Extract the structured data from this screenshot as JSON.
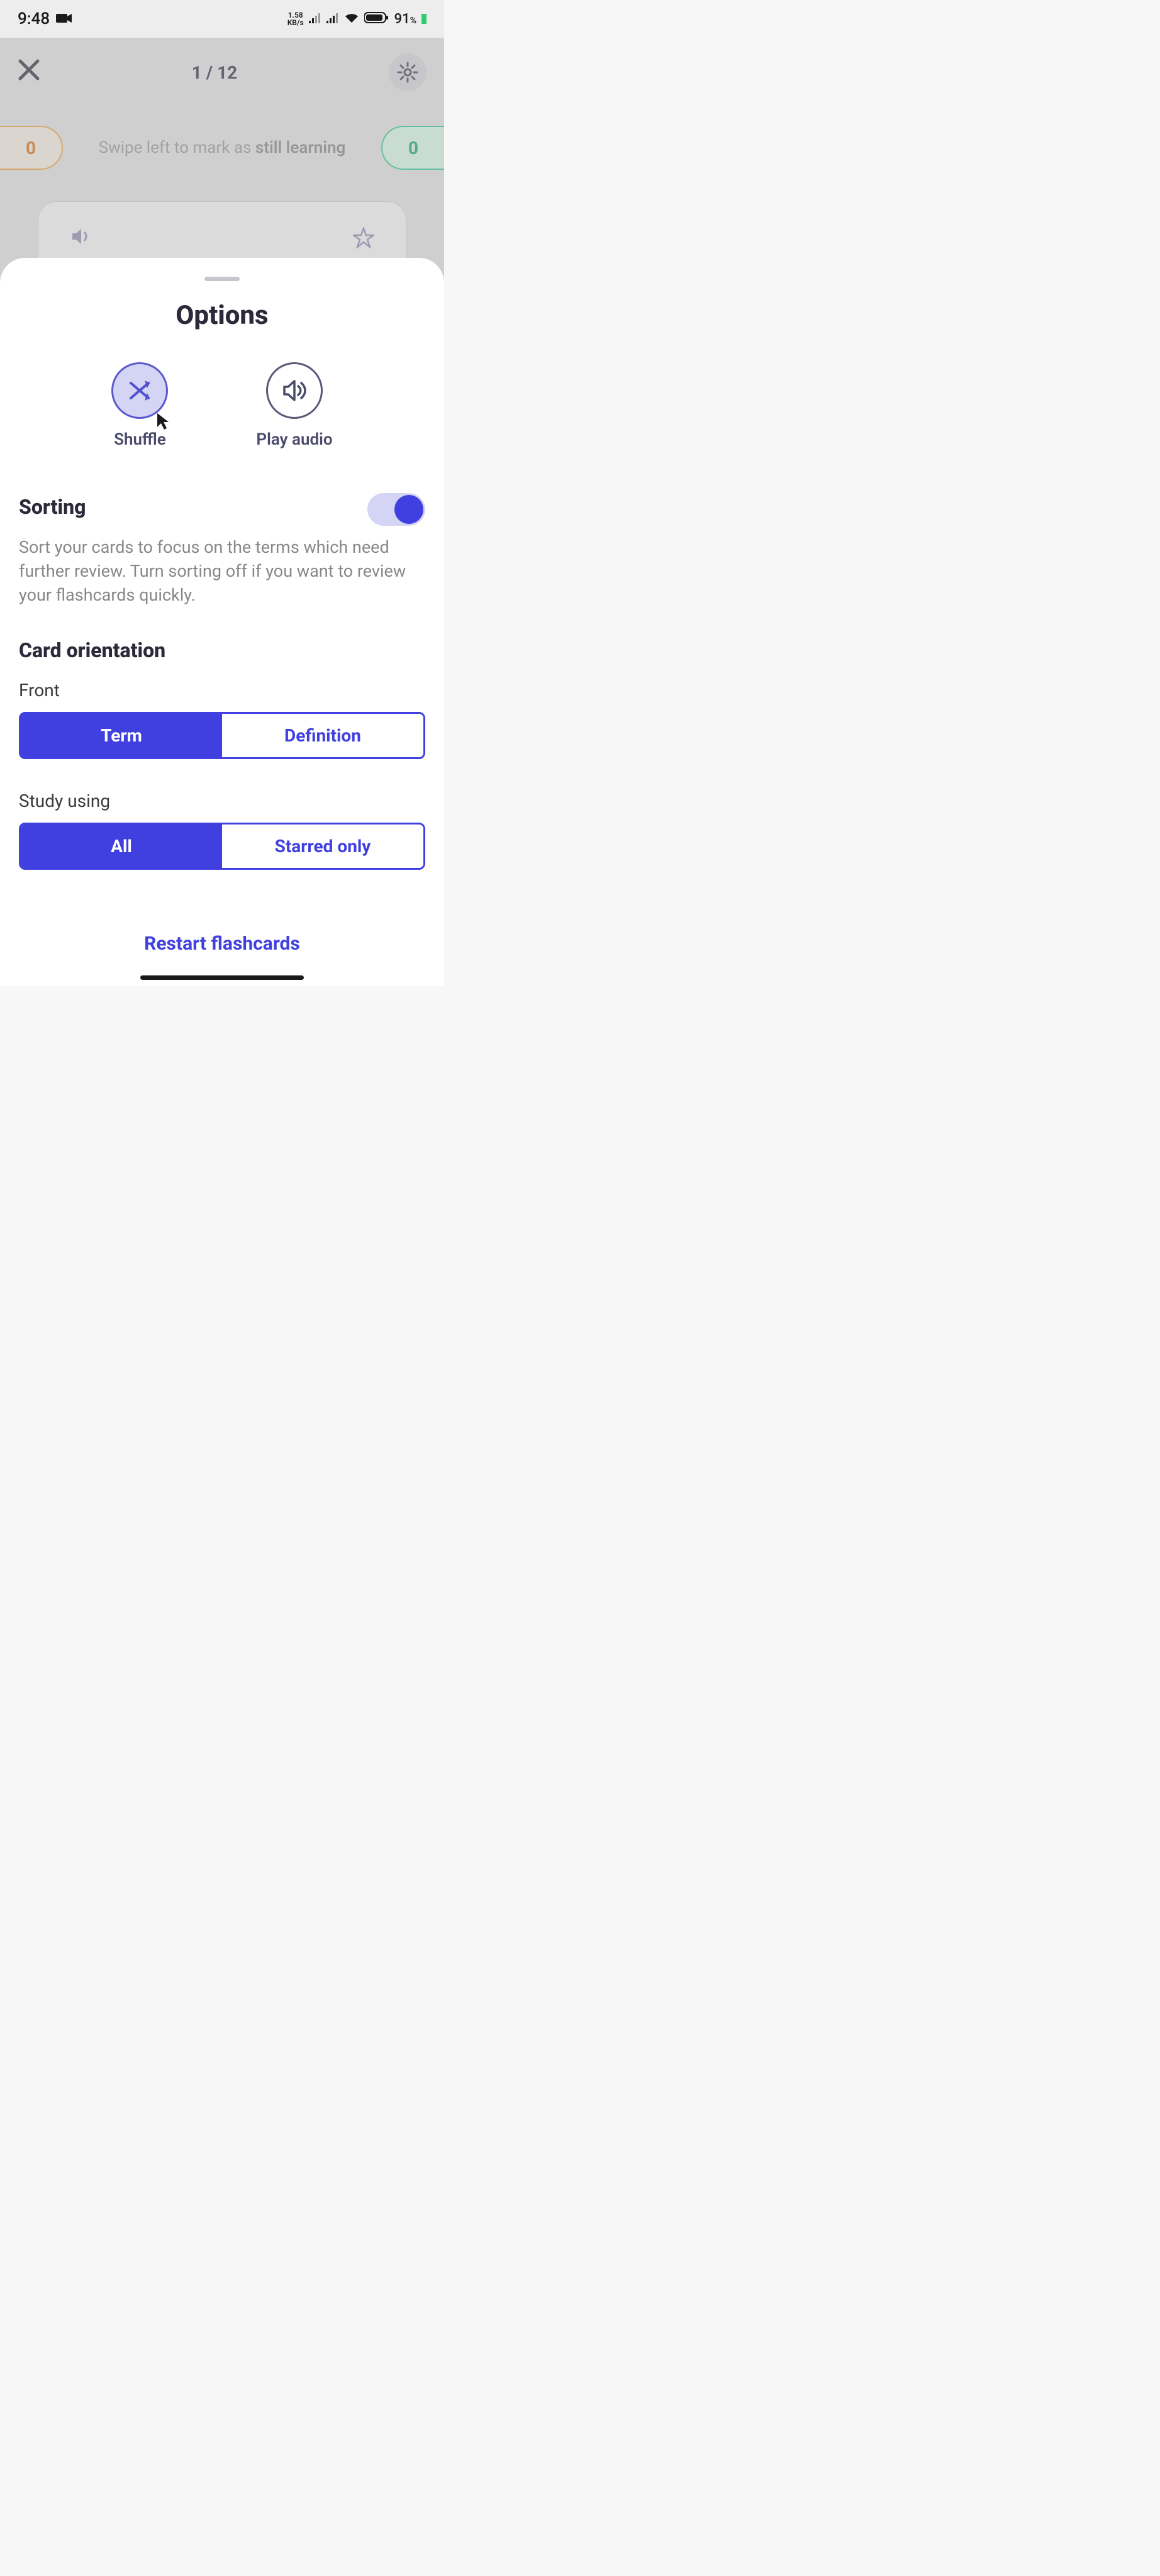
{
  "status": {
    "time": "9:48",
    "kbs_top": "1.58",
    "kbs_bottom": "KB/s",
    "battery": "91",
    "battery_suffix": "%"
  },
  "header": {
    "progress": "1 / 12"
  },
  "hint": {
    "left_count": "0",
    "right_count": "0",
    "prefix": "Swipe left to mark as ",
    "bold": "still learning"
  },
  "sheet": {
    "title": "Options",
    "shuffle_label": "Shuffle",
    "audio_label": "Play audio",
    "sorting_heading": "Sorting",
    "sorting_desc": "Sort your cards to focus on the terms which need further review. Turn sorting off if you want to review your flashcards quickly.",
    "orientation_heading": "Card orientation",
    "front_label": "Front",
    "term_label": "Term",
    "definition_label": "Definition",
    "study_using_label": "Study using",
    "all_label": "All",
    "starred_label": "Starred only",
    "restart_label": "Restart flashcards"
  }
}
